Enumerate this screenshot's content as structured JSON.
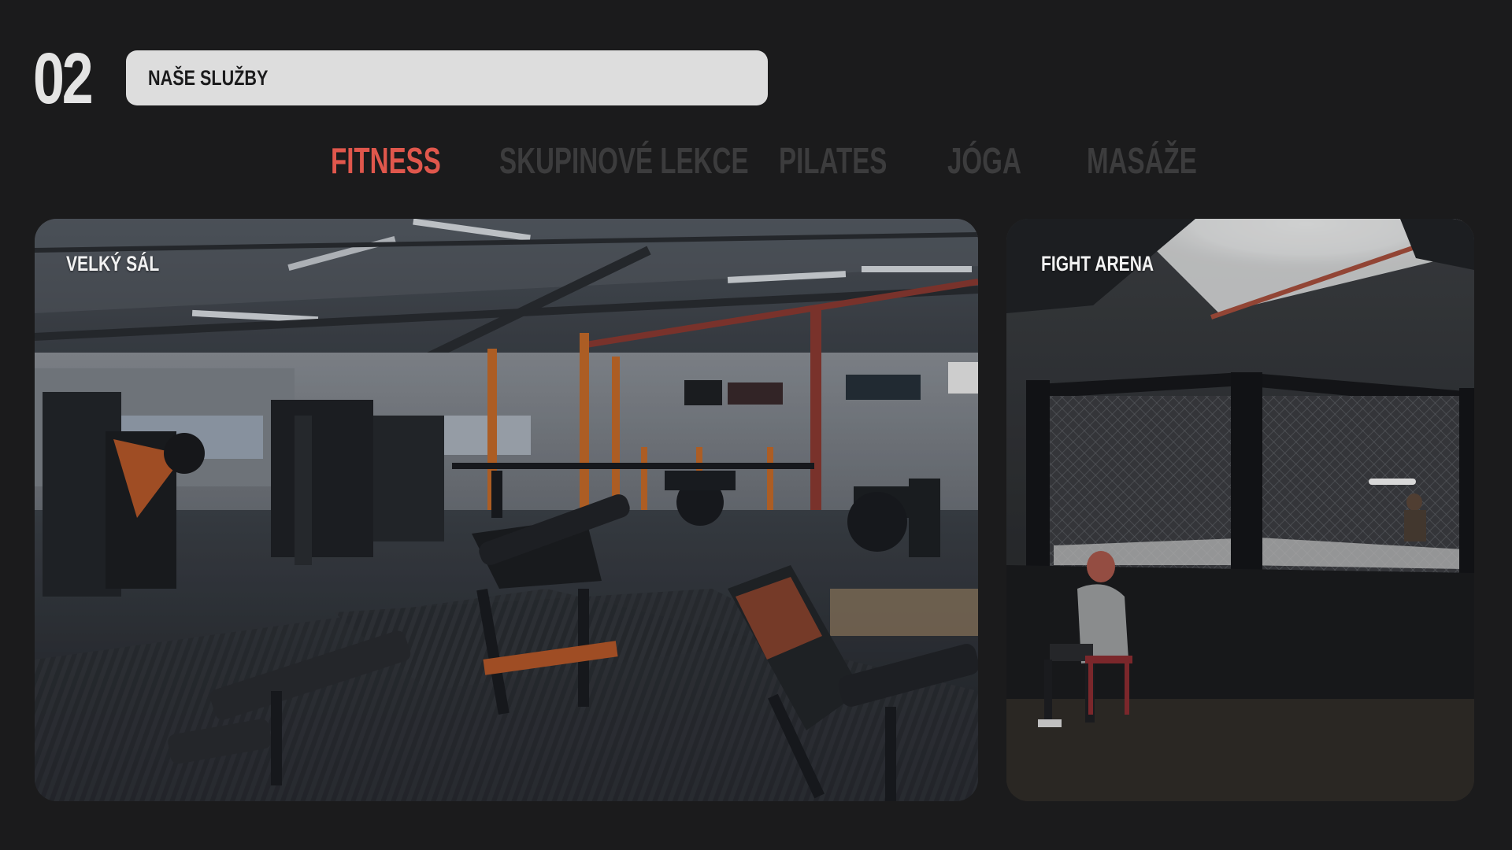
{
  "section": {
    "number": "02",
    "title": "NAŠE SLUŽBY"
  },
  "tabs": [
    {
      "label": "FITNESS",
      "active": true
    },
    {
      "label": "SKUPINOVÉ LEKCE",
      "active": false
    },
    {
      "label": "PILATES",
      "active": false
    },
    {
      "label": "JÓGA",
      "active": false
    },
    {
      "label": "MASÁŽE",
      "active": false
    }
  ],
  "cards": [
    {
      "label": "VELKÝ SÁL",
      "image": "gym-interior-photo"
    },
    {
      "label": "FIGHT ARENA",
      "image": "fight-cage-photo"
    }
  ],
  "colors": {
    "background": "#1b1b1c",
    "accent": "#e0574c",
    "tab_inactive": "#3c3c3d",
    "title_bar": "#dddddd"
  }
}
